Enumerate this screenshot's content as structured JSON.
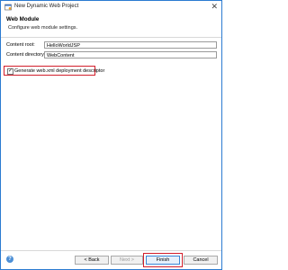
{
  "window": {
    "title": "New Dynamic Web Project",
    "close_glyph": "✕"
  },
  "header": {
    "title": "Web Module",
    "subtitle": "Configure web module settings."
  },
  "form": {
    "content_root_label": "Content root:",
    "content_root_value": "HelloWorldJSP",
    "content_dir_label": "Content directory:",
    "content_dir_value": "WebContent",
    "generate_label": "Generate web.xml deployment descriptor",
    "generate_checked": true
  },
  "footer": {
    "help_glyph": "?",
    "back_label": "< Back",
    "next_label": "Next >",
    "finish_label": "Finish",
    "cancel_label": "Cancel"
  },
  "colors": {
    "highlight": "#d21e2b",
    "window_border": "#2b7bd1",
    "help_blue": "#4c8fd6"
  }
}
